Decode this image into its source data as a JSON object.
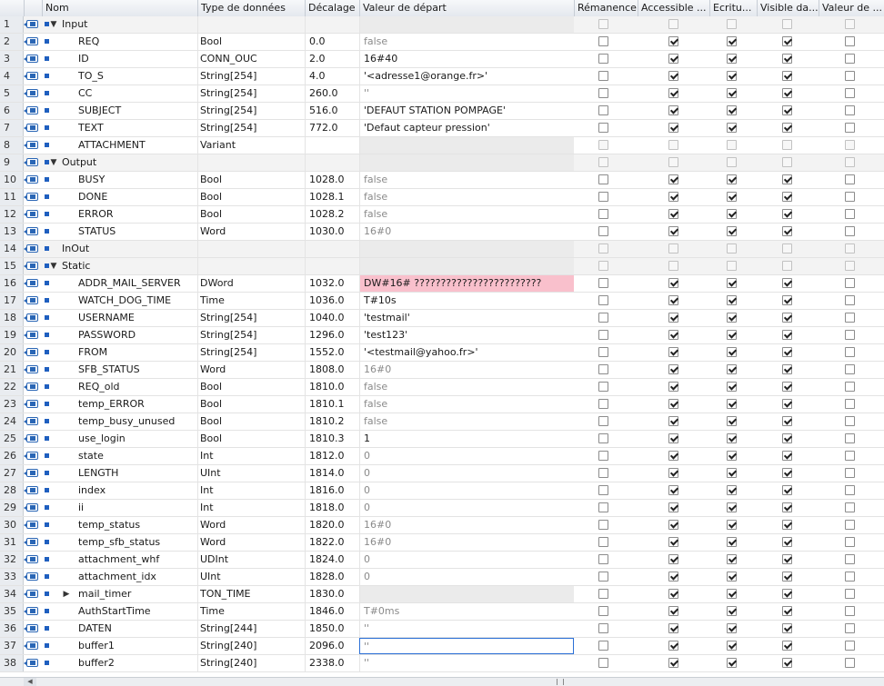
{
  "columns": {
    "name": "Nom",
    "type": "Type de données",
    "offset": "Décalage",
    "start": "Valeur de départ",
    "retain": "Rémanence",
    "accessible": "Accessible ...",
    "write": "Ecritu...",
    "visible": "Visible da...",
    "setpoint": "Valeur de ..."
  },
  "rows": [
    {
      "n": "1",
      "name": "Input",
      "type": "",
      "offset": "",
      "value": "",
      "kind": "section",
      "toggle": "▼",
      "checks": [
        0,
        0,
        0,
        0,
        0
      ],
      "disabled": [
        1,
        1,
        1,
        1,
        1
      ]
    },
    {
      "n": "2",
      "name": "REQ",
      "type": "Bool",
      "offset": "0.0",
      "value": "false",
      "kind": "child",
      "vstyle": "grey",
      "checks": [
        0,
        1,
        1,
        1,
        0
      ],
      "disabled": [
        0,
        0,
        0,
        0,
        0
      ]
    },
    {
      "n": "3",
      "name": "ID",
      "type": "CONN_OUC",
      "offset": "2.0",
      "value": "16#40",
      "kind": "child",
      "vstyle": "dark",
      "checks": [
        0,
        1,
        1,
        1,
        0
      ],
      "disabled": [
        0,
        0,
        0,
        0,
        0
      ]
    },
    {
      "n": "4",
      "name": "TO_S",
      "type": "String[254]",
      "offset": "4.0",
      "value": "'<adresse1@orange.fr>'",
      "kind": "child",
      "vstyle": "dark",
      "checks": [
        0,
        1,
        1,
        1,
        0
      ],
      "disabled": [
        0,
        0,
        0,
        0,
        0
      ]
    },
    {
      "n": "5",
      "name": "CC",
      "type": "String[254]",
      "offset": "260.0",
      "value": "''",
      "kind": "child",
      "vstyle": "grey",
      "checks": [
        0,
        1,
        1,
        1,
        0
      ],
      "disabled": [
        0,
        0,
        0,
        0,
        0
      ]
    },
    {
      "n": "6",
      "name": "SUBJECT",
      "type": "String[254]",
      "offset": "516.0",
      "value": "'DEFAUT STATION POMPAGE'",
      "kind": "child",
      "vstyle": "dark",
      "checks": [
        0,
        1,
        1,
        1,
        0
      ],
      "disabled": [
        0,
        0,
        0,
        0,
        0
      ]
    },
    {
      "n": "7",
      "name": "TEXT",
      "type": "String[254]",
      "offset": "772.0",
      "value": "'Defaut capteur pression'",
      "kind": "child",
      "vstyle": "dark",
      "checks": [
        0,
        1,
        1,
        1,
        0
      ],
      "disabled": [
        0,
        0,
        0,
        0,
        0
      ]
    },
    {
      "n": "8",
      "name": "ATTACHMENT",
      "type": "Variant",
      "offset": "",
      "value": "",
      "kind": "child",
      "vstyle": "empty",
      "checks": [
        0,
        0,
        0,
        0,
        0
      ],
      "disabled": [
        1,
        1,
        1,
        1,
        1
      ]
    },
    {
      "n": "9",
      "name": "Output",
      "type": "",
      "offset": "",
      "value": "",
      "kind": "section",
      "toggle": "▼",
      "checks": [
        0,
        0,
        0,
        0,
        0
      ],
      "disabled": [
        1,
        1,
        1,
        1,
        1
      ]
    },
    {
      "n": "10",
      "name": "BUSY",
      "type": "Bool",
      "offset": "1028.0",
      "value": "false",
      "kind": "child",
      "vstyle": "grey",
      "checks": [
        0,
        1,
        1,
        1,
        0
      ],
      "disabled": [
        0,
        0,
        0,
        0,
        0
      ]
    },
    {
      "n": "11",
      "name": "DONE",
      "type": "Bool",
      "offset": "1028.1",
      "value": "false",
      "kind": "child",
      "vstyle": "grey",
      "checks": [
        0,
        1,
        1,
        1,
        0
      ],
      "disabled": [
        0,
        0,
        0,
        0,
        0
      ]
    },
    {
      "n": "12",
      "name": "ERROR",
      "type": "Bool",
      "offset": "1028.2",
      "value": "false",
      "kind": "child",
      "vstyle": "grey",
      "checks": [
        0,
        1,
        1,
        1,
        0
      ],
      "disabled": [
        0,
        0,
        0,
        0,
        0
      ]
    },
    {
      "n": "13",
      "name": "STATUS",
      "type": "Word",
      "offset": "1030.0",
      "value": "16#0",
      "kind": "child",
      "vstyle": "grey",
      "checks": [
        0,
        1,
        1,
        1,
        0
      ],
      "disabled": [
        0,
        0,
        0,
        0,
        0
      ]
    },
    {
      "n": "14",
      "name": "InOut",
      "type": "",
      "offset": "",
      "value": "",
      "kind": "section",
      "toggle": "",
      "checks": [
        0,
        0,
        0,
        0,
        0
      ],
      "disabled": [
        1,
        1,
        1,
        1,
        1
      ]
    },
    {
      "n": "15",
      "name": "Static",
      "type": "",
      "offset": "",
      "value": "",
      "kind": "section",
      "toggle": "▼",
      "checks": [
        0,
        0,
        0,
        0,
        0
      ],
      "disabled": [
        1,
        1,
        1,
        1,
        1
      ]
    },
    {
      "n": "16",
      "name": "ADDR_MAIL_SERVER",
      "type": "DWord",
      "offset": "1032.0",
      "value": "DW#16# ????????????????????????",
      "kind": "child",
      "vstyle": "err",
      "checks": [
        0,
        1,
        1,
        1,
        0
      ],
      "disabled": [
        0,
        0,
        0,
        0,
        0
      ]
    },
    {
      "n": "17",
      "name": "WATCH_DOG_TIME",
      "type": "Time",
      "offset": "1036.0",
      "value": "T#10s",
      "kind": "child",
      "vstyle": "dark",
      "checks": [
        0,
        1,
        1,
        1,
        0
      ],
      "disabled": [
        0,
        0,
        0,
        0,
        0
      ]
    },
    {
      "n": "18",
      "name": "USERNAME",
      "type": "String[254]",
      "offset": "1040.0",
      "value": "'testmail'",
      "kind": "child",
      "vstyle": "dark",
      "checks": [
        0,
        1,
        1,
        1,
        0
      ],
      "disabled": [
        0,
        0,
        0,
        0,
        0
      ]
    },
    {
      "n": "19",
      "name": "PASSWORD",
      "type": "String[254]",
      "offset": "1296.0",
      "value": "'test123'",
      "kind": "child",
      "vstyle": "dark",
      "checks": [
        0,
        1,
        1,
        1,
        0
      ],
      "disabled": [
        0,
        0,
        0,
        0,
        0
      ]
    },
    {
      "n": "20",
      "name": "FROM",
      "type": "String[254]",
      "offset": "1552.0",
      "value": "'<testmail@yahoo.fr>'",
      "kind": "child",
      "vstyle": "dark",
      "checks": [
        0,
        1,
        1,
        1,
        0
      ],
      "disabled": [
        0,
        0,
        0,
        0,
        0
      ]
    },
    {
      "n": "21",
      "name": "SFB_STATUS",
      "type": "Word",
      "offset": "1808.0",
      "value": "16#0",
      "kind": "child",
      "vstyle": "grey",
      "checks": [
        0,
        1,
        1,
        1,
        0
      ],
      "disabled": [
        0,
        0,
        0,
        0,
        0
      ]
    },
    {
      "n": "22",
      "name": "REQ_old",
      "type": "Bool",
      "offset": "1810.0",
      "value": "false",
      "kind": "child",
      "vstyle": "grey",
      "checks": [
        0,
        1,
        1,
        1,
        0
      ],
      "disabled": [
        0,
        0,
        0,
        0,
        0
      ]
    },
    {
      "n": "23",
      "name": "temp_ERROR",
      "type": "Bool",
      "offset": "1810.1",
      "value": "false",
      "kind": "child",
      "vstyle": "grey",
      "checks": [
        0,
        1,
        1,
        1,
        0
      ],
      "disabled": [
        0,
        0,
        0,
        0,
        0
      ]
    },
    {
      "n": "24",
      "name": "temp_busy_unused",
      "type": "Bool",
      "offset": "1810.2",
      "value": "false",
      "kind": "child",
      "vstyle": "grey",
      "checks": [
        0,
        1,
        1,
        1,
        0
      ],
      "disabled": [
        0,
        0,
        0,
        0,
        0
      ]
    },
    {
      "n": "25",
      "name": "use_login",
      "type": "Bool",
      "offset": "1810.3",
      "value": "1",
      "kind": "child",
      "vstyle": "dark",
      "checks": [
        0,
        1,
        1,
        1,
        0
      ],
      "disabled": [
        0,
        0,
        0,
        0,
        0
      ]
    },
    {
      "n": "26",
      "name": "state",
      "type": "Int",
      "offset": "1812.0",
      "value": "0",
      "kind": "child",
      "vstyle": "grey",
      "checks": [
        0,
        1,
        1,
        1,
        0
      ],
      "disabled": [
        0,
        0,
        0,
        0,
        0
      ]
    },
    {
      "n": "27",
      "name": "LENGTH",
      "type": "UInt",
      "offset": "1814.0",
      "value": "0",
      "kind": "child",
      "vstyle": "grey",
      "checks": [
        0,
        1,
        1,
        1,
        0
      ],
      "disabled": [
        0,
        0,
        0,
        0,
        0
      ]
    },
    {
      "n": "28",
      "name": "index",
      "type": "Int",
      "offset": "1816.0",
      "value": "0",
      "kind": "child",
      "vstyle": "grey",
      "checks": [
        0,
        1,
        1,
        1,
        0
      ],
      "disabled": [
        0,
        0,
        0,
        0,
        0
      ]
    },
    {
      "n": "29",
      "name": "ii",
      "type": "Int",
      "offset": "1818.0",
      "value": "0",
      "kind": "child",
      "vstyle": "grey",
      "checks": [
        0,
        1,
        1,
        1,
        0
      ],
      "disabled": [
        0,
        0,
        0,
        0,
        0
      ]
    },
    {
      "n": "30",
      "name": "temp_status",
      "type": "Word",
      "offset": "1820.0",
      "value": "16#0",
      "kind": "child",
      "vstyle": "grey",
      "checks": [
        0,
        1,
        1,
        1,
        0
      ],
      "disabled": [
        0,
        0,
        0,
        0,
        0
      ]
    },
    {
      "n": "31",
      "name": "temp_sfb_status",
      "type": "Word",
      "offset": "1822.0",
      "value": "16#0",
      "kind": "child",
      "vstyle": "grey",
      "checks": [
        0,
        1,
        1,
        1,
        0
      ],
      "disabled": [
        0,
        0,
        0,
        0,
        0
      ]
    },
    {
      "n": "32",
      "name": "attachment_whf",
      "type": "UDInt",
      "offset": "1824.0",
      "value": "0",
      "kind": "child",
      "vstyle": "grey",
      "checks": [
        0,
        1,
        1,
        1,
        0
      ],
      "disabled": [
        0,
        0,
        0,
        0,
        0
      ]
    },
    {
      "n": "33",
      "name": "attachment_idx",
      "type": "UInt",
      "offset": "1828.0",
      "value": "0",
      "kind": "child",
      "vstyle": "grey",
      "checks": [
        0,
        1,
        1,
        1,
        0
      ],
      "disabled": [
        0,
        0,
        0,
        0,
        0
      ]
    },
    {
      "n": "34",
      "name": "mail_timer",
      "type": "TON_TIME",
      "offset": "1830.0",
      "value": "",
      "kind": "child",
      "toggle": "▶",
      "vstyle": "empty",
      "checks": [
        0,
        1,
        1,
        1,
        0
      ],
      "disabled": [
        0,
        0,
        0,
        0,
        0
      ]
    },
    {
      "n": "35",
      "name": "AuthStartTime",
      "type": "Time",
      "offset": "1846.0",
      "value": "T#0ms",
      "kind": "child",
      "vstyle": "grey",
      "checks": [
        0,
        1,
        1,
        1,
        0
      ],
      "disabled": [
        0,
        0,
        0,
        0,
        0
      ]
    },
    {
      "n": "36",
      "name": "DATEN",
      "type": "String[244]",
      "offset": "1850.0",
      "value": "''",
      "kind": "child",
      "vstyle": "grey",
      "checks": [
        0,
        1,
        1,
        1,
        0
      ],
      "disabled": [
        0,
        0,
        0,
        0,
        0
      ]
    },
    {
      "n": "37",
      "name": "buffer1",
      "type": "String[240]",
      "offset": "2096.0",
      "value": "''",
      "kind": "child",
      "vstyle": "sel",
      "checks": [
        0,
        1,
        1,
        1,
        0
      ],
      "disabled": [
        0,
        0,
        0,
        0,
        0
      ]
    },
    {
      "n": "38",
      "name": "buffer2",
      "type": "String[240]",
      "offset": "2338.0",
      "value": "''",
      "kind": "child",
      "vstyle": "grey",
      "checks": [
        0,
        1,
        1,
        1,
        0
      ],
      "disabled": [
        0,
        0,
        0,
        0,
        0
      ]
    }
  ]
}
